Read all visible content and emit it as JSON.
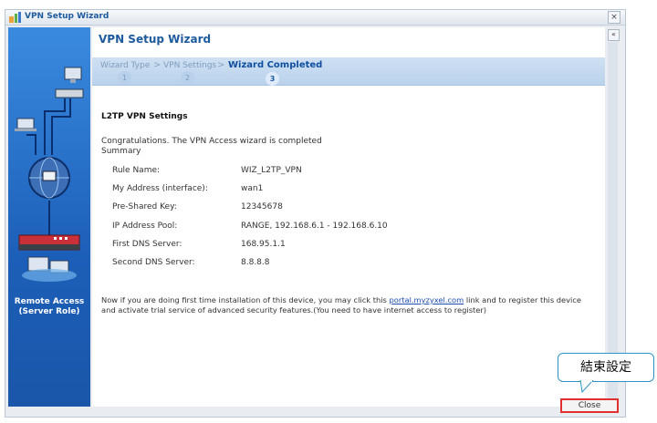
{
  "window": {
    "title": "VPN Setup Wizard",
    "close_glyph": "×",
    "collapse_glyph": "«"
  },
  "sidebar": {
    "label_line1": "Remote Access",
    "label_line2": "(Server Role)"
  },
  "header": {
    "title": "VPN Setup Wizard"
  },
  "steps": [
    {
      "label": "Wizard Type",
      "number": "1",
      "active": false
    },
    {
      "label": "VPN Settings",
      "number": "2",
      "active": false
    },
    {
      "label": "Wizard Completed",
      "number": "3",
      "active": true
    }
  ],
  "step_separator": ">",
  "main": {
    "section_title": "L2TP VPN Settings",
    "congrats": "Congratulations. The VPN Access wizard is completed",
    "summary_label": "Summary",
    "rows": [
      {
        "label": "Rule Name:",
        "value": "WIZ_L2TP_VPN"
      },
      {
        "label": "My Address (interface):",
        "value": "wan1"
      },
      {
        "label": "Pre-Shared Key:",
        "value": "12345678"
      },
      {
        "label": "IP Address Pool:",
        "value": "RANGE, 192.168.6.1 - 192.168.6.10"
      },
      {
        "label": "First DNS Server:",
        "value": "168.95.1.1"
      },
      {
        "label": "Second DNS Server:",
        "value": "8.8.8.8"
      }
    ],
    "note_part1": "Now if you are doing first time installation of this device, you may click this ",
    "note_link": "portal.myzyxel.com",
    "note_part2": " link and to register this device",
    "note_line2": "and activate trial service of advanced security features.(You need to have internet access to register)"
  },
  "footer": {
    "close_label": "Close"
  },
  "annotation": {
    "callout_text": "結束設定"
  },
  "colors": {
    "accent": "#1d5a9e",
    "highlight_border": "#e0302f",
    "callout_border": "#2d93c8"
  }
}
